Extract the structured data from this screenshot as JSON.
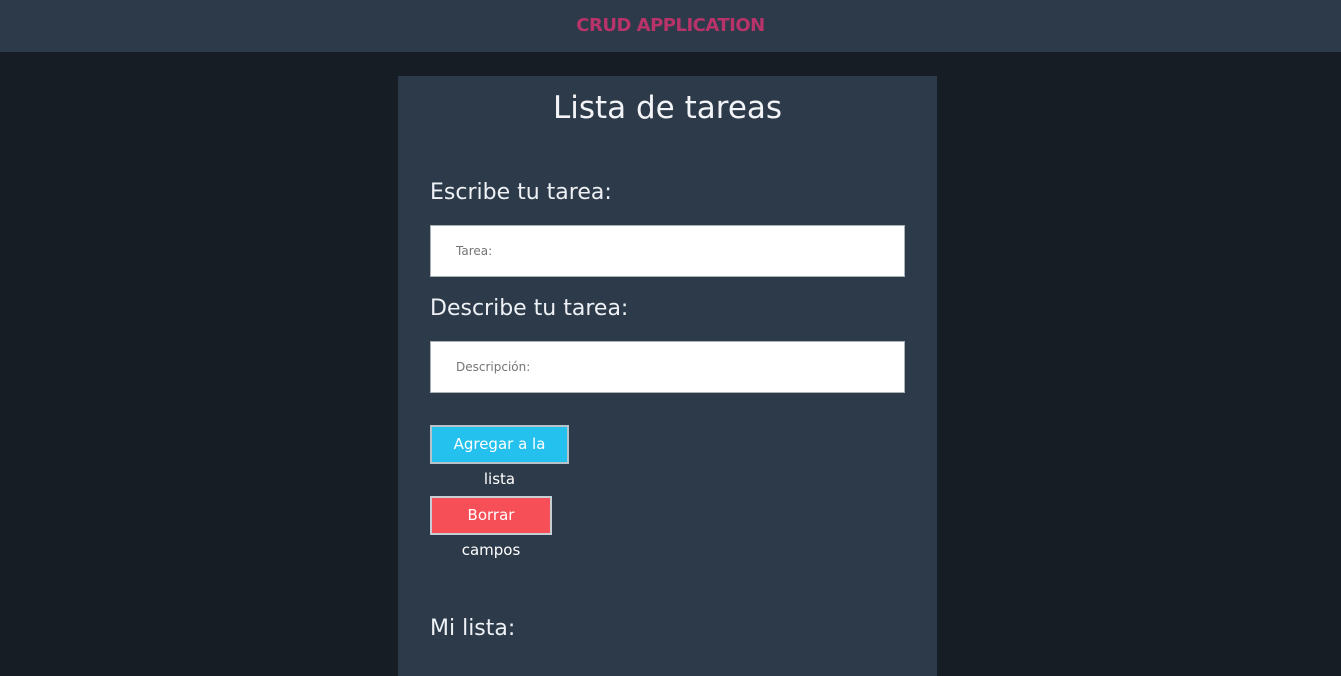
{
  "header": {
    "brand": "CRUD APPLICATION"
  },
  "panel": {
    "title": "Lista de tareas"
  },
  "form": {
    "task_label": "Escribe tu tarea:",
    "task_placeholder": "Tarea:",
    "task_value": "",
    "description_label": "Describe tu tarea:",
    "description_placeholder": "Descripción:",
    "description_value": "",
    "add_button": "Agregar a la lista",
    "clear_button": "Borrar campos"
  },
  "list": {
    "title": "Mi lista:"
  },
  "colors": {
    "header_bg": "#2c3a49",
    "page_bg": "#171d25",
    "brand": "#b8336a",
    "add_button": "#24c1ee",
    "clear_button": "#f74f57"
  }
}
